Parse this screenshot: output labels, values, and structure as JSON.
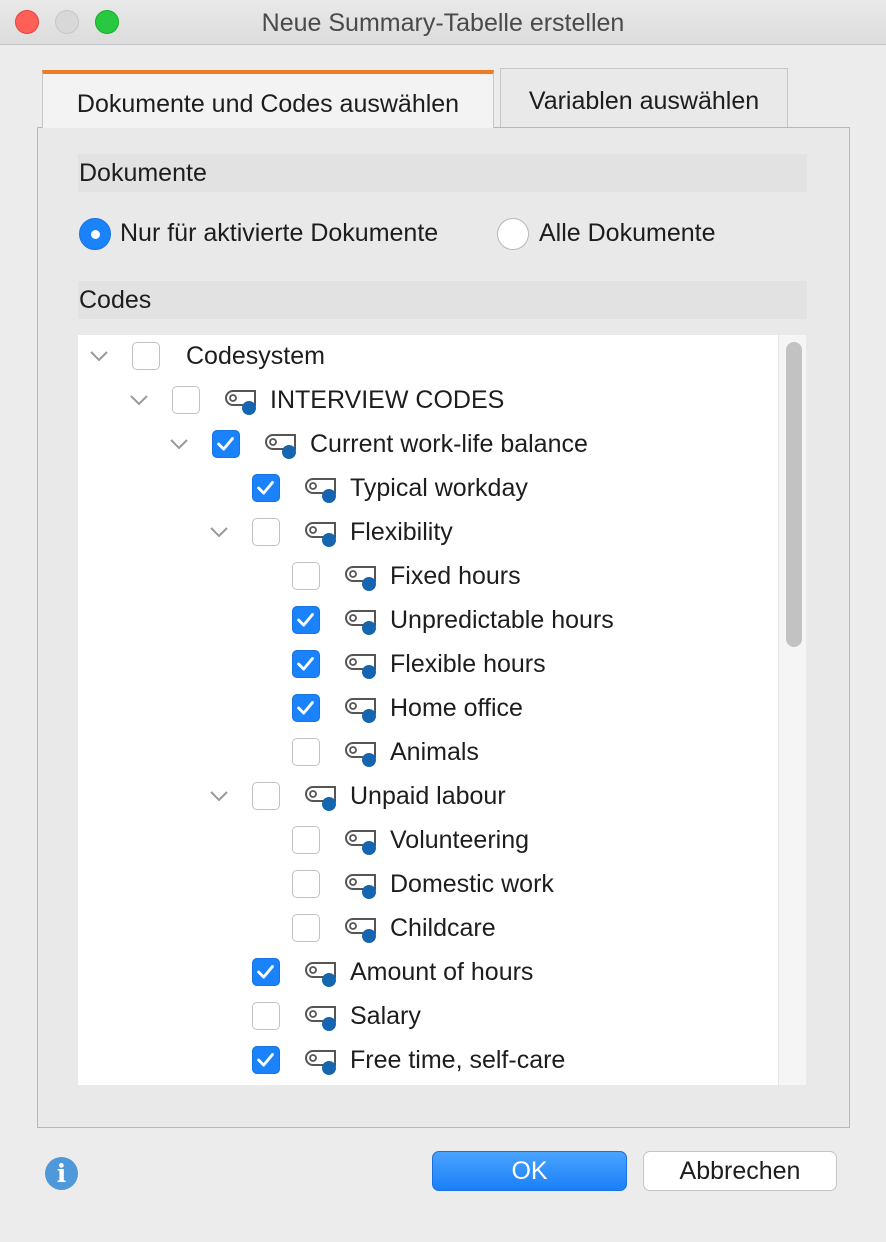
{
  "window": {
    "title": "Neue Summary-Tabelle erstellen"
  },
  "tabs": [
    {
      "label": "Dokumente und Codes auswählen",
      "active": true
    },
    {
      "label": "Variablen auswählen",
      "active": false
    }
  ],
  "documents": {
    "header": "Dokumente",
    "options": [
      {
        "label": "Nur für aktivierte Dokumente",
        "selected": true
      },
      {
        "label": "Alle Dokumente",
        "selected": false
      }
    ]
  },
  "codes": {
    "header": "Codes",
    "tree": [
      {
        "label": "Codesystem",
        "level": 0,
        "expanded": true,
        "checked": false,
        "icon": "none"
      },
      {
        "label": "INTERVIEW CODES",
        "level": 1,
        "expanded": true,
        "checked": false,
        "icon": "code-icon"
      },
      {
        "label": "Current work-life balance",
        "level": 2,
        "expanded": true,
        "checked": true,
        "icon": "code-icon"
      },
      {
        "label": "Typical workday",
        "level": 3,
        "expanded": null,
        "checked": true,
        "icon": "code-icon"
      },
      {
        "label": "Flexibility",
        "level": 3,
        "expanded": true,
        "checked": false,
        "icon": "code-icon"
      },
      {
        "label": "Fixed hours",
        "level": 4,
        "expanded": null,
        "checked": false,
        "icon": "code-icon"
      },
      {
        "label": "Unpredictable hours",
        "level": 4,
        "expanded": null,
        "checked": true,
        "icon": "code-icon"
      },
      {
        "label": "Flexible hours",
        "level": 4,
        "expanded": null,
        "checked": true,
        "icon": "code-icon"
      },
      {
        "label": "Home office",
        "level": 4,
        "expanded": null,
        "checked": true,
        "icon": "code-icon"
      },
      {
        "label": "Animals",
        "level": 4,
        "expanded": null,
        "checked": false,
        "icon": "code-icon"
      },
      {
        "label": "Unpaid labour",
        "level": 3,
        "expanded": true,
        "checked": false,
        "icon": "code-icon"
      },
      {
        "label": "Volunteering",
        "level": 4,
        "expanded": null,
        "checked": false,
        "icon": "code-icon"
      },
      {
        "label": "Domestic work",
        "level": 4,
        "expanded": null,
        "checked": false,
        "icon": "code-icon"
      },
      {
        "label": "Childcare",
        "level": 4,
        "expanded": null,
        "checked": false,
        "icon": "code-icon"
      },
      {
        "label": "Amount of hours",
        "level": 3,
        "expanded": null,
        "checked": true,
        "icon": "code-icon"
      },
      {
        "label": "Salary",
        "level": 3,
        "expanded": null,
        "checked": false,
        "icon": "code-icon"
      },
      {
        "label": "Free time, self-care",
        "level": 3,
        "expanded": null,
        "checked": true,
        "icon": "code-icon"
      }
    ]
  },
  "footer": {
    "info_icon": "info-icon",
    "ok_label": "OK",
    "cancel_label": "Abbrechen"
  },
  "colors": {
    "accent": "#1a82fb",
    "tab_indicator": "#f07b26",
    "code_dot": "#1565b0"
  }
}
